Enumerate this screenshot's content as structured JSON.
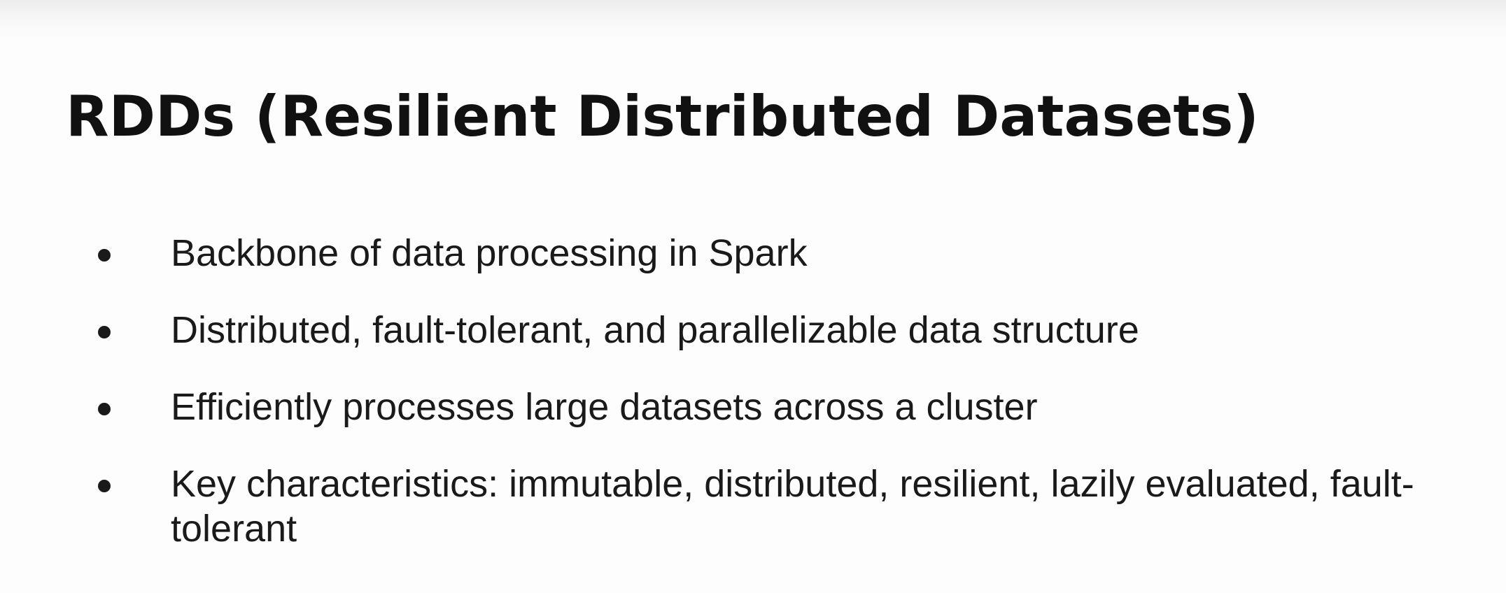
{
  "slide": {
    "title": "RDDs (Resilient Distributed Datasets)",
    "bullets": [
      "Backbone of data processing in Spark",
      "Distributed, fault-tolerant, and parallelizable data structure",
      "Efficiently processes large datasets across a cluster",
      "Key characteristics: immutable, distributed, resilient, lazily evaluated, fault-tolerant"
    ]
  }
}
